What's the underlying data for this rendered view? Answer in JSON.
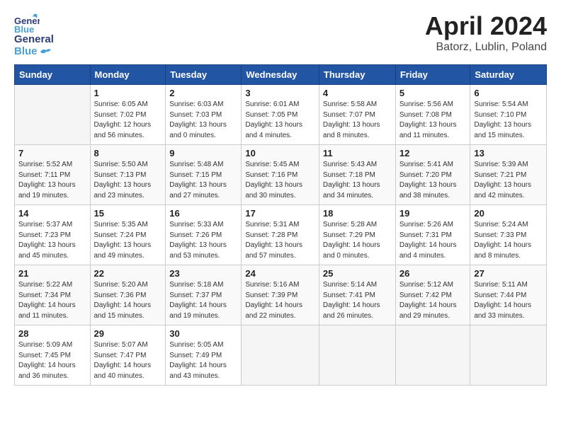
{
  "header": {
    "logo_general": "General",
    "logo_blue": "Blue",
    "month": "April 2024",
    "location": "Batorz, Lublin, Poland"
  },
  "weekdays": [
    "Sunday",
    "Monday",
    "Tuesday",
    "Wednesday",
    "Thursday",
    "Friday",
    "Saturday"
  ],
  "weeks": [
    [
      {
        "day": "",
        "info": ""
      },
      {
        "day": "1",
        "info": "Sunrise: 6:05 AM\nSunset: 7:02 PM\nDaylight: 12 hours\nand 56 minutes."
      },
      {
        "day": "2",
        "info": "Sunrise: 6:03 AM\nSunset: 7:03 PM\nDaylight: 13 hours\nand 0 minutes."
      },
      {
        "day": "3",
        "info": "Sunrise: 6:01 AM\nSunset: 7:05 PM\nDaylight: 13 hours\nand 4 minutes."
      },
      {
        "day": "4",
        "info": "Sunrise: 5:58 AM\nSunset: 7:07 PM\nDaylight: 13 hours\nand 8 minutes."
      },
      {
        "day": "5",
        "info": "Sunrise: 5:56 AM\nSunset: 7:08 PM\nDaylight: 13 hours\nand 11 minutes."
      },
      {
        "day": "6",
        "info": "Sunrise: 5:54 AM\nSunset: 7:10 PM\nDaylight: 13 hours\nand 15 minutes."
      }
    ],
    [
      {
        "day": "7",
        "info": "Sunrise: 5:52 AM\nSunset: 7:11 PM\nDaylight: 13 hours\nand 19 minutes."
      },
      {
        "day": "8",
        "info": "Sunrise: 5:50 AM\nSunset: 7:13 PM\nDaylight: 13 hours\nand 23 minutes."
      },
      {
        "day": "9",
        "info": "Sunrise: 5:48 AM\nSunset: 7:15 PM\nDaylight: 13 hours\nand 27 minutes."
      },
      {
        "day": "10",
        "info": "Sunrise: 5:45 AM\nSunset: 7:16 PM\nDaylight: 13 hours\nand 30 minutes."
      },
      {
        "day": "11",
        "info": "Sunrise: 5:43 AM\nSunset: 7:18 PM\nDaylight: 13 hours\nand 34 minutes."
      },
      {
        "day": "12",
        "info": "Sunrise: 5:41 AM\nSunset: 7:20 PM\nDaylight: 13 hours\nand 38 minutes."
      },
      {
        "day": "13",
        "info": "Sunrise: 5:39 AM\nSunset: 7:21 PM\nDaylight: 13 hours\nand 42 minutes."
      }
    ],
    [
      {
        "day": "14",
        "info": "Sunrise: 5:37 AM\nSunset: 7:23 PM\nDaylight: 13 hours\nand 45 minutes."
      },
      {
        "day": "15",
        "info": "Sunrise: 5:35 AM\nSunset: 7:24 PM\nDaylight: 13 hours\nand 49 minutes."
      },
      {
        "day": "16",
        "info": "Sunrise: 5:33 AM\nSunset: 7:26 PM\nDaylight: 13 hours\nand 53 minutes."
      },
      {
        "day": "17",
        "info": "Sunrise: 5:31 AM\nSunset: 7:28 PM\nDaylight: 13 hours\nand 57 minutes."
      },
      {
        "day": "18",
        "info": "Sunrise: 5:28 AM\nSunset: 7:29 PM\nDaylight: 14 hours\nand 0 minutes."
      },
      {
        "day": "19",
        "info": "Sunrise: 5:26 AM\nSunset: 7:31 PM\nDaylight: 14 hours\nand 4 minutes."
      },
      {
        "day": "20",
        "info": "Sunrise: 5:24 AM\nSunset: 7:33 PM\nDaylight: 14 hours\nand 8 minutes."
      }
    ],
    [
      {
        "day": "21",
        "info": "Sunrise: 5:22 AM\nSunset: 7:34 PM\nDaylight: 14 hours\nand 11 minutes."
      },
      {
        "day": "22",
        "info": "Sunrise: 5:20 AM\nSunset: 7:36 PM\nDaylight: 14 hours\nand 15 minutes."
      },
      {
        "day": "23",
        "info": "Sunrise: 5:18 AM\nSunset: 7:37 PM\nDaylight: 14 hours\nand 19 minutes."
      },
      {
        "day": "24",
        "info": "Sunrise: 5:16 AM\nSunset: 7:39 PM\nDaylight: 14 hours\nand 22 minutes."
      },
      {
        "day": "25",
        "info": "Sunrise: 5:14 AM\nSunset: 7:41 PM\nDaylight: 14 hours\nand 26 minutes."
      },
      {
        "day": "26",
        "info": "Sunrise: 5:12 AM\nSunset: 7:42 PM\nDaylight: 14 hours\nand 29 minutes."
      },
      {
        "day": "27",
        "info": "Sunrise: 5:11 AM\nSunset: 7:44 PM\nDaylight: 14 hours\nand 33 minutes."
      }
    ],
    [
      {
        "day": "28",
        "info": "Sunrise: 5:09 AM\nSunset: 7:45 PM\nDaylight: 14 hours\nand 36 minutes."
      },
      {
        "day": "29",
        "info": "Sunrise: 5:07 AM\nSunset: 7:47 PM\nDaylight: 14 hours\nand 40 minutes."
      },
      {
        "day": "30",
        "info": "Sunrise: 5:05 AM\nSunset: 7:49 PM\nDaylight: 14 hours\nand 43 minutes."
      },
      {
        "day": "",
        "info": ""
      },
      {
        "day": "",
        "info": ""
      },
      {
        "day": "",
        "info": ""
      },
      {
        "day": "",
        "info": ""
      }
    ]
  ]
}
